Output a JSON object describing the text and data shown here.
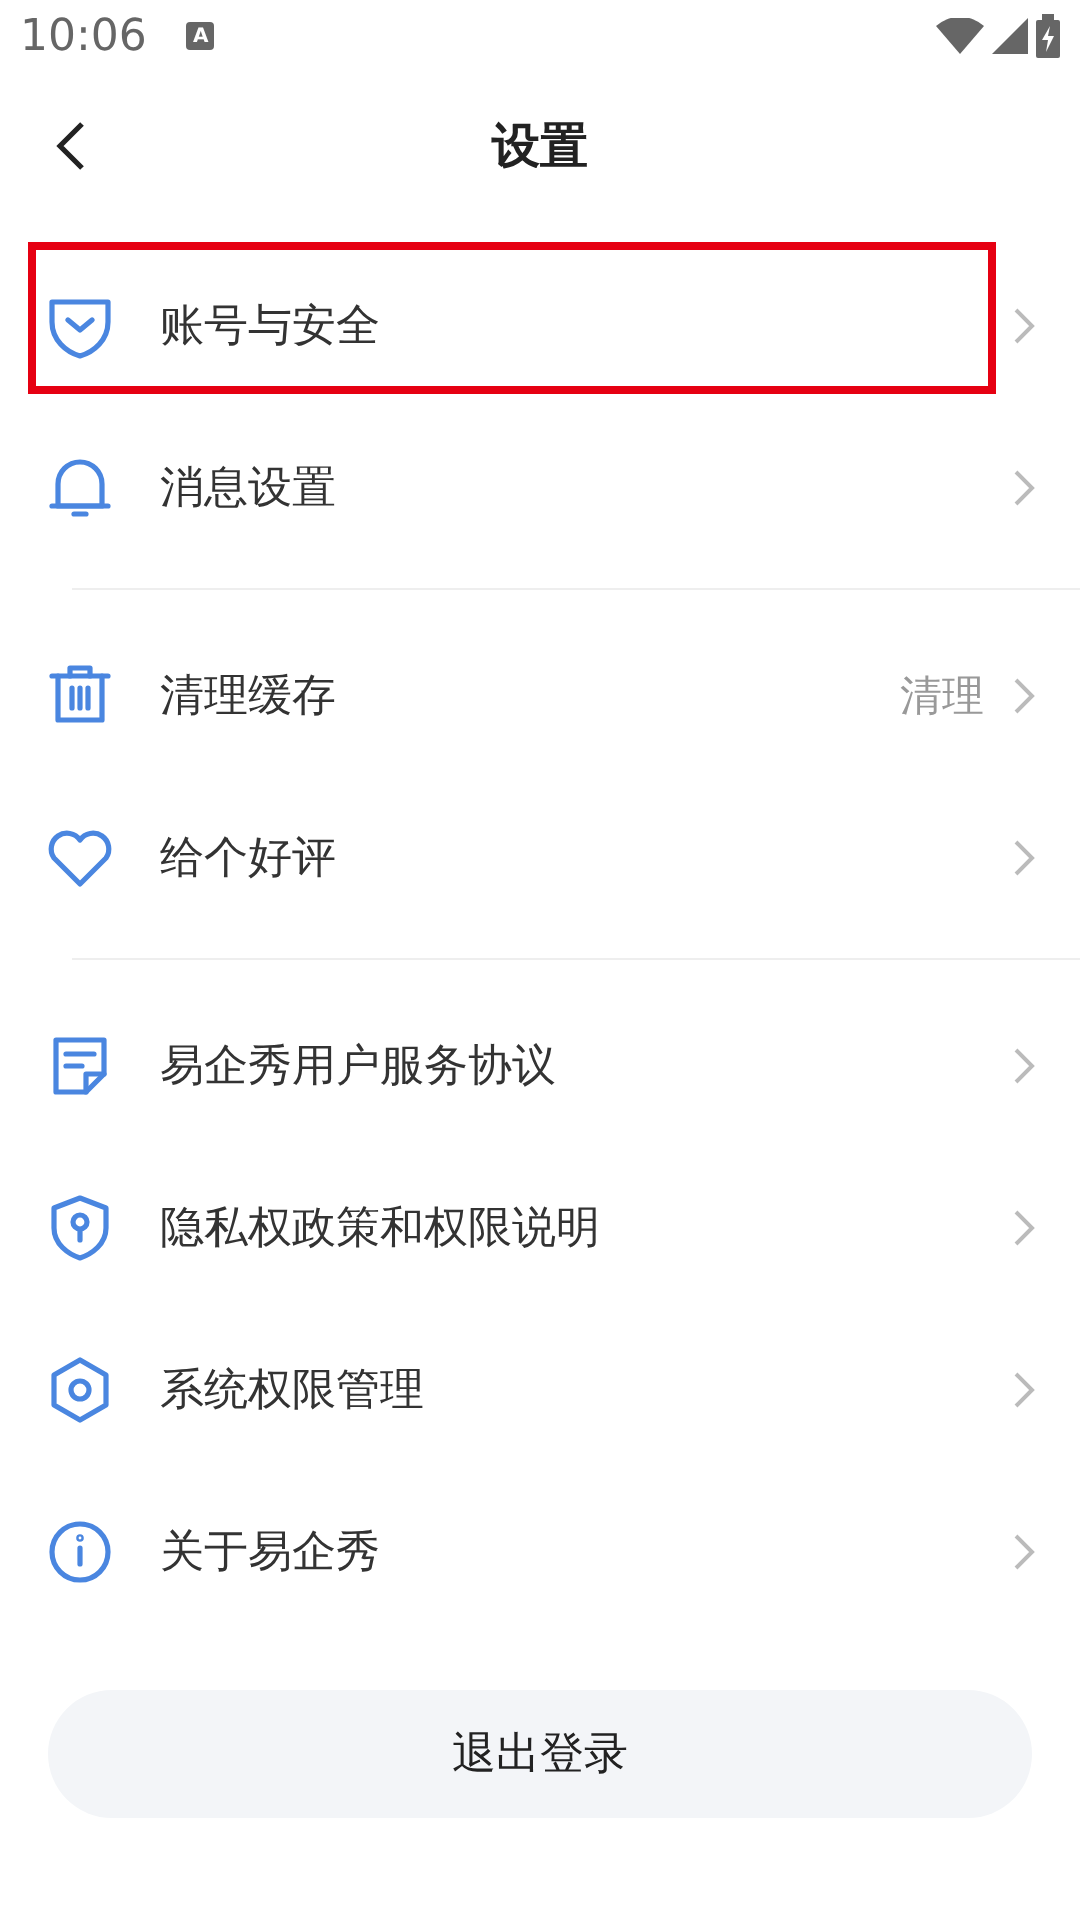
{
  "status_bar": {
    "time": "10:06",
    "notification": "A"
  },
  "header": {
    "title": "设置"
  },
  "groups": [
    {
      "items": [
        {
          "kind": "shield-check",
          "label": "账号与安全",
          "highlighted": true
        },
        {
          "kind": "bell",
          "label": "消息设置",
          "highlighted": false
        }
      ]
    },
    {
      "items": [
        {
          "kind": "trash",
          "label": "清理缓存",
          "value": "清理",
          "highlighted": false
        },
        {
          "kind": "heart",
          "label": "给个好评",
          "highlighted": false
        }
      ]
    },
    {
      "items": [
        {
          "kind": "document",
          "label": "易企秀用户服务协议",
          "highlighted": false
        },
        {
          "kind": "shield-key",
          "label": "隐私权政策和权限说明",
          "highlighted": false
        },
        {
          "kind": "hexagon",
          "label": "系统权限管理",
          "highlighted": false
        },
        {
          "kind": "info",
          "label": "关于易企秀",
          "highlighted": false
        }
      ]
    }
  ],
  "logout_button": "退出登录"
}
